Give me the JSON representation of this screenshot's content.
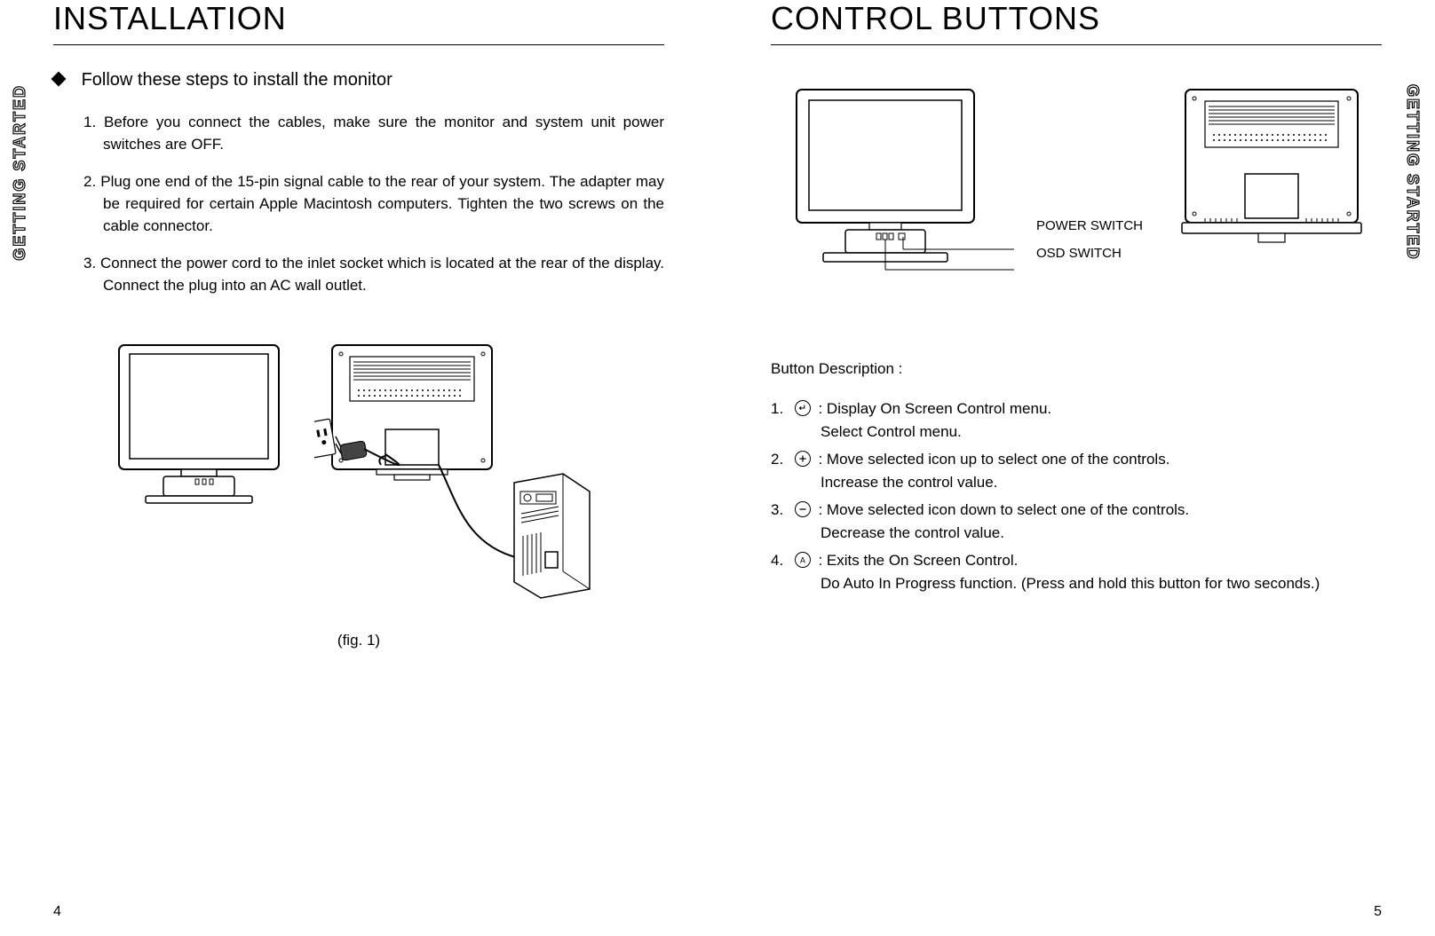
{
  "sideTab": "GETTING STARTED",
  "left": {
    "title": "INSTALLATION",
    "lead": "Follow these steps to install the monitor",
    "steps": [
      "1. Before you connect the cables, make sure the monitor and system unit power switches are OFF.",
      "2. Plug one end of the 15-pin signal cable to the rear of your system. The adapter may be required for certain Apple Macintosh computers. Tighten the two screws on the cable connector.",
      "3. Connect the power cord to the inlet socket which is located at the rear of the display. Connect the plug  into an AC wall outlet."
    ],
    "figCaption": "(fig. 1)",
    "pageNum": "4"
  },
  "right": {
    "title": "CONTROL BUTTONS",
    "diagramLabels": {
      "power": "POWER SWITCH",
      "osd": "OSD SWITCH"
    },
    "btnDescHeading": "Button Description :",
    "buttons": [
      {
        "num": "1.",
        "icon": "enter",
        "line1": ": Display On Screen Control menu.",
        "line2": "Select Control menu."
      },
      {
        "num": "2.",
        "icon": "plus",
        "line1": ": Move selected icon up to select one of the controls.",
        "line2": "Increase the control value."
      },
      {
        "num": "3.",
        "icon": "minus",
        "line1": ": Move selected icon down to select one of the controls.",
        "line2": "Decrease the control value."
      },
      {
        "num": "4.",
        "icon": "A",
        "line1": ": Exits the On Screen Control.",
        "line2": "Do Auto In Progress function. (Press and hold this button for two seconds.)"
      }
    ],
    "pageNum": "5"
  }
}
